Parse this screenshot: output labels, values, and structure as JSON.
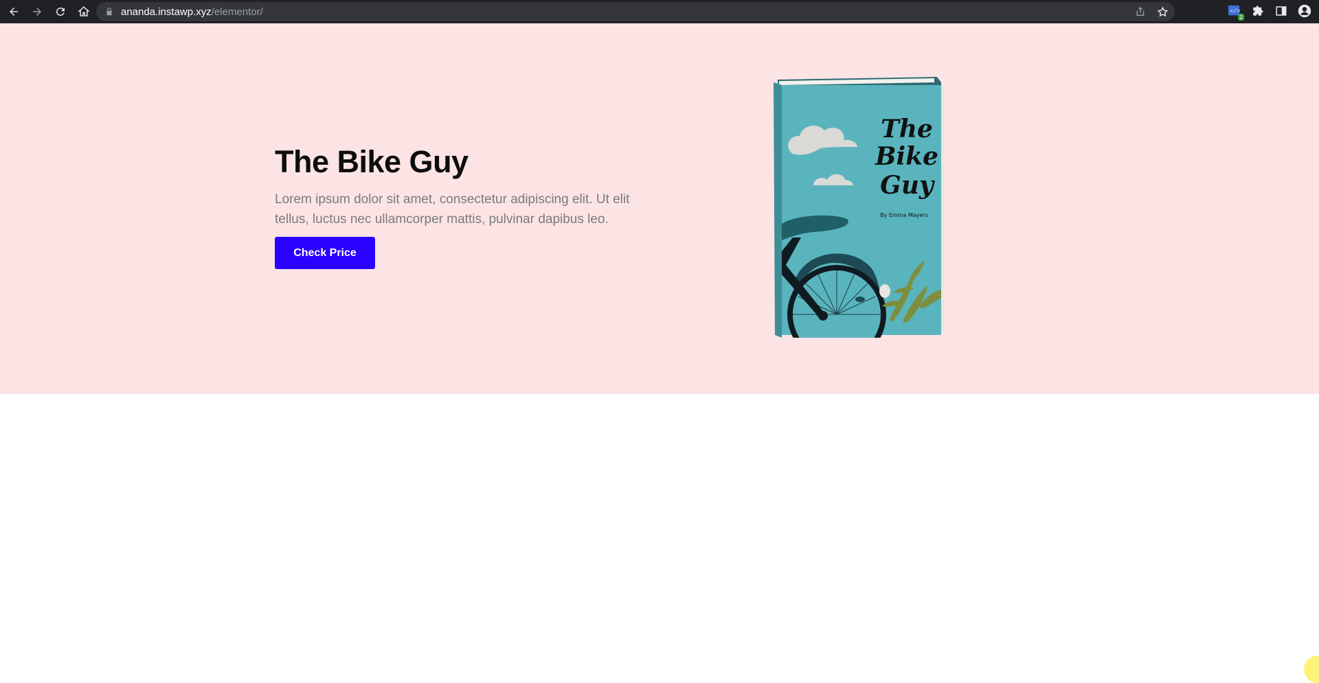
{
  "browser": {
    "url_host": "ananda.instawp.xyz",
    "url_path": "/elementor/",
    "extension_badge": "2",
    "icons": [
      "back-icon",
      "forward-icon",
      "reload-icon",
      "home-icon",
      "lock-icon",
      "share-icon",
      "star-icon",
      "extension-icon",
      "puzzle-icon",
      "sidebar-icon",
      "profile-icon"
    ]
  },
  "hero": {
    "title": "The Bike Guy",
    "description": "Lorem ipsum dolor sit amet, consectetur adipiscing elit. Ut elit tellus, luctus nec ullamcorper mattis, pulvinar dapibus leo.",
    "cta_label": "Check Price",
    "background": "#fde4e4",
    "cta_color": "#2a00ff"
  },
  "book": {
    "cover_title_line1": "The",
    "cover_title_line2": "Bike",
    "cover_title_line3": "Guy",
    "author": "By Emma Mayers",
    "cover_color": "#5ab4bd"
  }
}
